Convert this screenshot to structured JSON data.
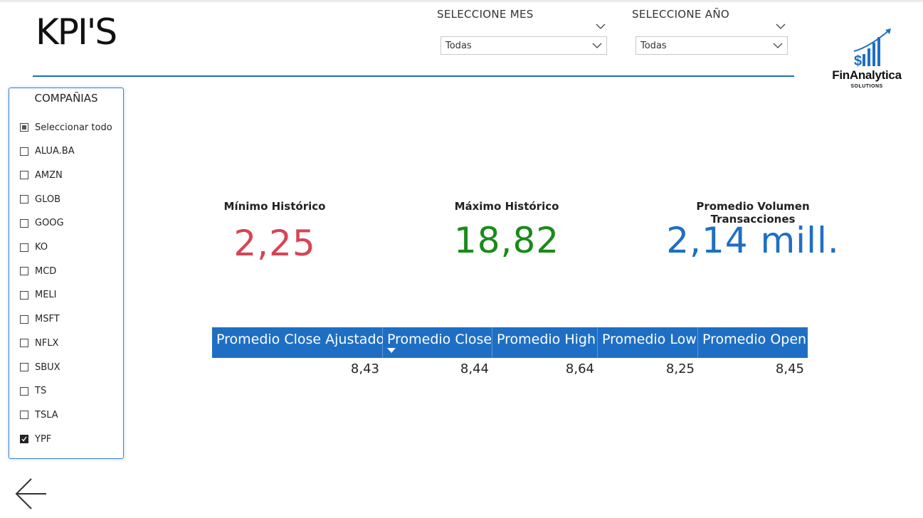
{
  "page": {
    "title": "KPI'S"
  },
  "filters": {
    "month": {
      "title": "SELECCIONE MES",
      "value": "Todas"
    },
    "year": {
      "title": "SELECCIONE AÑO",
      "value": "Todas"
    }
  },
  "logo": {
    "name": "FinAnalytica",
    "tagline": "SOLUTIONS",
    "symbol": "$"
  },
  "companies": {
    "title": "COMPAÑIAS",
    "items": [
      {
        "label": "Seleccionar todo",
        "state": "partial"
      },
      {
        "label": "ALUA.BA",
        "state": "unchecked"
      },
      {
        "label": "AMZN",
        "state": "unchecked"
      },
      {
        "label": "GLOB",
        "state": "unchecked"
      },
      {
        "label": "GOOG",
        "state": "unchecked"
      },
      {
        "label": "KO",
        "state": "unchecked"
      },
      {
        "label": "MCD",
        "state": "unchecked"
      },
      {
        "label": "MELI",
        "state": "unchecked"
      },
      {
        "label": "MSFT",
        "state": "unchecked"
      },
      {
        "label": "NFLX",
        "state": "unchecked"
      },
      {
        "label": "SBUX",
        "state": "unchecked"
      },
      {
        "label": "TS",
        "state": "unchecked"
      },
      {
        "label": "TSLA",
        "state": "unchecked"
      },
      {
        "label": "YPF",
        "state": "checked"
      }
    ]
  },
  "kpis": {
    "min": {
      "label": "Mínimo Histórico",
      "value": "2,25",
      "color": "#d64554"
    },
    "max": {
      "label": "Máximo Histórico",
      "value": "18,82",
      "color": "#1a8a1a"
    },
    "volume": {
      "label": "Promedio Volumen Transacciones",
      "value": "2,14 mill.",
      "color": "#1e6fc4"
    }
  },
  "table": {
    "headers": [
      "Promedio Close Ajustado",
      "Promedio Close",
      "Promedio High",
      "Promedio Low",
      "Promedio Open"
    ],
    "sorted_column": "Promedio Close",
    "rows": [
      [
        "8,43",
        "8,44",
        "8,64",
        "8,25",
        "8,45"
      ]
    ]
  },
  "colors": {
    "accent": "#1e6fc4",
    "header_rule": "#1a6fbf"
  }
}
